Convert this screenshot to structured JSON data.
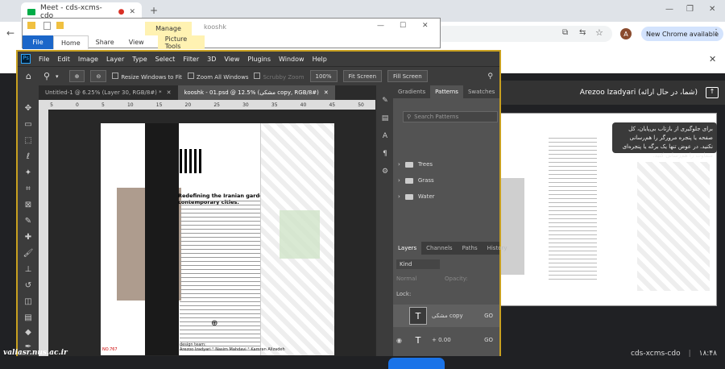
{
  "browser": {
    "tab_title": "Meet - cds-xcms-cdo",
    "new_chrome": "New Chrome available"
  },
  "explorer": {
    "manage": "Manage",
    "title": "kooshk",
    "tabs": [
      "File",
      "Home",
      "Share",
      "View",
      "Picture Tools"
    ]
  },
  "photoshop": {
    "menu": [
      "File",
      "Edit",
      "Image",
      "Layer",
      "Type",
      "Select",
      "Filter",
      "3D",
      "View",
      "Plugins",
      "Window",
      "Help"
    ],
    "options": {
      "resize": "Resize Windows to Fit",
      "zoom_all": "Zoom All Windows",
      "scrubby": "Scrubby Zoom",
      "zoom_value": "100%",
      "fit_screen": "Fit Screen",
      "fill_screen": "Fill Screen"
    },
    "doc_tabs": [
      {
        "label": "Untitled-1 @ 6.25% (Layer 30, RGB/8#) *"
      },
      {
        "label": "kooshk - 01.psd @ 12.5% (مشکی copy, RGB/8#)"
      }
    ],
    "ruler_ticks": [
      "5",
      "0",
      "5",
      "10",
      "15",
      "20",
      "25",
      "30",
      "35",
      "40",
      "45",
      "50"
    ],
    "document": {
      "heading": "Redefining the Iranian garden \"kushk\" in contemporary cities.",
      "page_no": "NO.767",
      "sign_line1": "design team:",
      "sign_line2": "Arezoo Izadyari ° Nasim Mahdavi ° Kamran Alizadeh"
    },
    "panels": {
      "top_tabs": [
        "Gradients",
        "Patterns",
        "Swatches"
      ],
      "search_placeholder": "Search Patterns",
      "folders": [
        "Trees",
        "Grass",
        "Water"
      ],
      "layer_tabs": [
        "Layers",
        "Channels",
        "Paths",
        "History"
      ],
      "kind": "Kind",
      "normal": "Normal",
      "opacity": "Opacity:",
      "lock": "Lock:",
      "layers": [
        {
          "name": "مشکی copy",
          "suffix": "GO"
        },
        {
          "name": "+ 0.00",
          "suffix": "GO"
        }
      ]
    }
  },
  "meet": {
    "presenter": "Arezoo Izadyari (شما، در حال ارائه)",
    "bubble": "برای جلوگیری از بازتاب بی‌پایان، کل صفحه یا پنجره مرورگر را هم‌رسانی نکنید. در عوض تنها یک برگه یا پنجره‌ای متفاوت را هم‌رسانی کنید.",
    "meeting_code": "cds-xcms-cdo",
    "time": "۱۸:۴۸"
  },
  "watermark": "valiasr.nus.ac.ir"
}
